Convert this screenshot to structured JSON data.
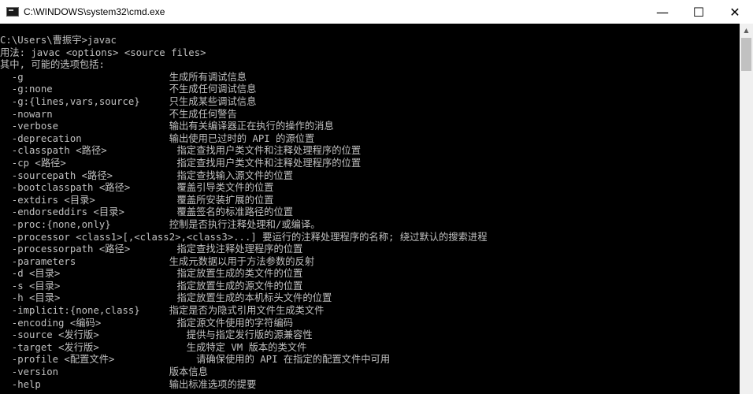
{
  "window": {
    "title": "C:\\WINDOWS\\system32\\cmd.exe",
    "controls": {
      "minimize": "—",
      "maximize": "☐",
      "close": "✕"
    }
  },
  "terminal": {
    "lines": [
      "C:\\Users\\曹振宇>javac",
      "用法: javac <options> <source files>",
      "其中, 可能的选项包括:",
      "  -g                         生成所有调试信息",
      "  -g:none                    不生成任何调试信息",
      "  -g:{lines,vars,source}     只生成某些调试信息",
      "  -nowarn                    不生成任何警告",
      "  -verbose                   输出有关编译器正在执行的操作的消息",
      "  -deprecation               输出使用已过时的 API 的源位置",
      "  -classpath <路径>            指定查找用户类文件和注释处理程序的位置",
      "  -cp <路径>                   指定查找用户类文件和注释处理程序的位置",
      "  -sourcepath <路径>           指定查找输入源文件的位置",
      "  -bootclasspath <路径>        覆盖引导类文件的位置",
      "  -extdirs <目录>              覆盖所安装扩展的位置",
      "  -endorseddirs <目录>         覆盖签名的标准路径的位置",
      "  -proc:{none,only}          控制是否执行注释处理和/或编译。",
      "  -processor <class1>[,<class2>,<class3>...] 要运行的注释处理程序的名称; 绕过默认的搜索进程",
      "  -processorpath <路径>        指定查找注释处理程序的位置",
      "  -parameters                生成元数据以用于方法参数的反射",
      "  -d <目录>                    指定放置生成的类文件的位置",
      "  -s <目录>                    指定放置生成的源文件的位置",
      "  -h <目录>                    指定放置生成的本机标头文件的位置",
      "  -implicit:{none,class}     指定是否为隐式引用文件生成类文件",
      "  -encoding <编码>             指定源文件使用的字符编码",
      "  -source <发行版>               提供与指定发行版的源兼容性",
      "  -target <发行版>               生成特定 VM 版本的类文件",
      "  -profile <配置文件>              请确保使用的 API 在指定的配置文件中可用",
      "  -version                   版本信息",
      "  -help                      输出标准选项的提要"
    ]
  }
}
